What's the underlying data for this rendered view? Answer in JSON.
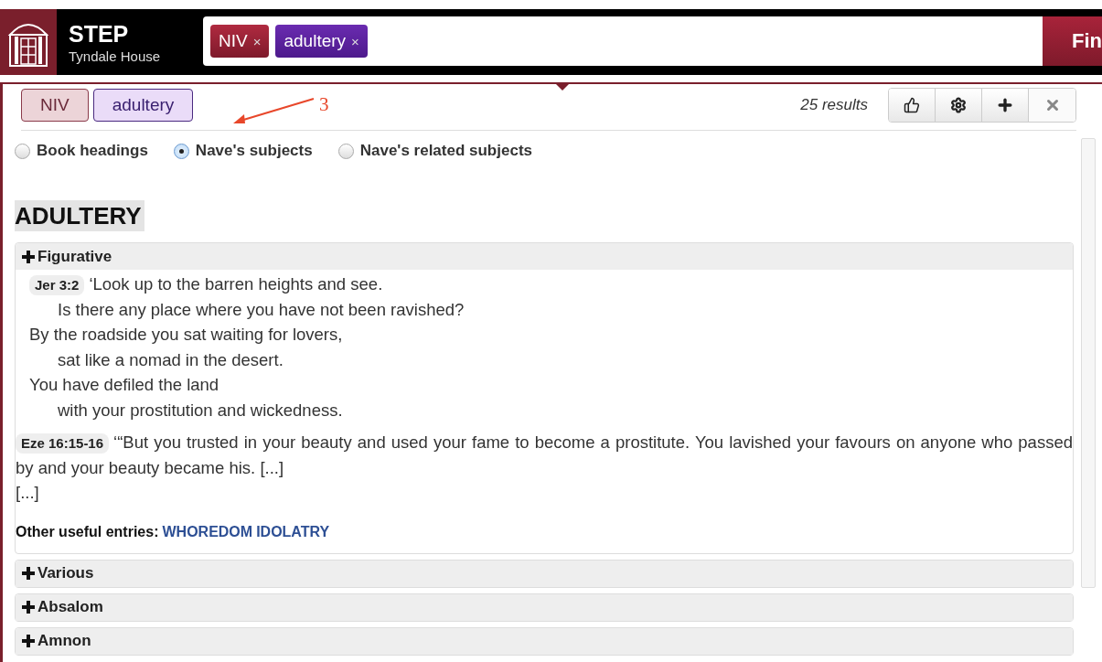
{
  "header": {
    "title": "STEP",
    "subtitle": "Tyndale House",
    "search_tags": [
      {
        "label": "NIV",
        "remove": "×",
        "kind": "version"
      },
      {
        "label": "adultery",
        "remove": "×",
        "kind": "subject"
      }
    ],
    "find_button": "Fin"
  },
  "panel": {
    "tags": [
      {
        "label": "NIV",
        "kind": "version"
      },
      {
        "label": "adultery",
        "kind": "subject"
      }
    ],
    "results": "25 results",
    "annotation": {
      "label": "3"
    },
    "options": [
      {
        "label": "Book headings",
        "selected": false
      },
      {
        "label": "Nave's subjects",
        "selected": true
      },
      {
        "label": "Nave's related subjects",
        "selected": false
      }
    ],
    "heading": "ADULTERY",
    "sections": [
      {
        "title": "Figurative",
        "expanded": true,
        "passages": [
          {
            "ref": "Jer 3:2",
            "kind": "poetry",
            "lines": [
              {
                "text": "‘Look up to the barren heights and see.",
                "indent": false
              },
              {
                "text": "Is there any place where you have not been ravished?",
                "indent": true
              },
              {
                "text": "By the roadside you sat waiting for lovers,",
                "indent": false
              },
              {
                "text": "sat like a nomad in the desert.",
                "indent": true
              },
              {
                "text": "You have defiled the land",
                "indent": false
              },
              {
                "text": "with your prostitution and wickedness.",
                "indent": true
              }
            ]
          },
          {
            "ref": "Eze 16:15-16",
            "kind": "prose",
            "lines": [
              {
                "text": "‘“But you trusted in your beauty and used your fame to become a prostitute. You lavished your favours on anyone who passed by and your beauty became his. [...]"
              },
              {
                "text": "[...]"
              }
            ]
          }
        ],
        "other_label": "Other useful entries:",
        "other_links": [
          "WHOREDOM",
          "IDOLATRY"
        ]
      },
      {
        "title": "Various",
        "expanded": false
      },
      {
        "title": "Absalom",
        "expanded": false
      },
      {
        "title": "Amnon",
        "expanded": false
      }
    ]
  }
}
